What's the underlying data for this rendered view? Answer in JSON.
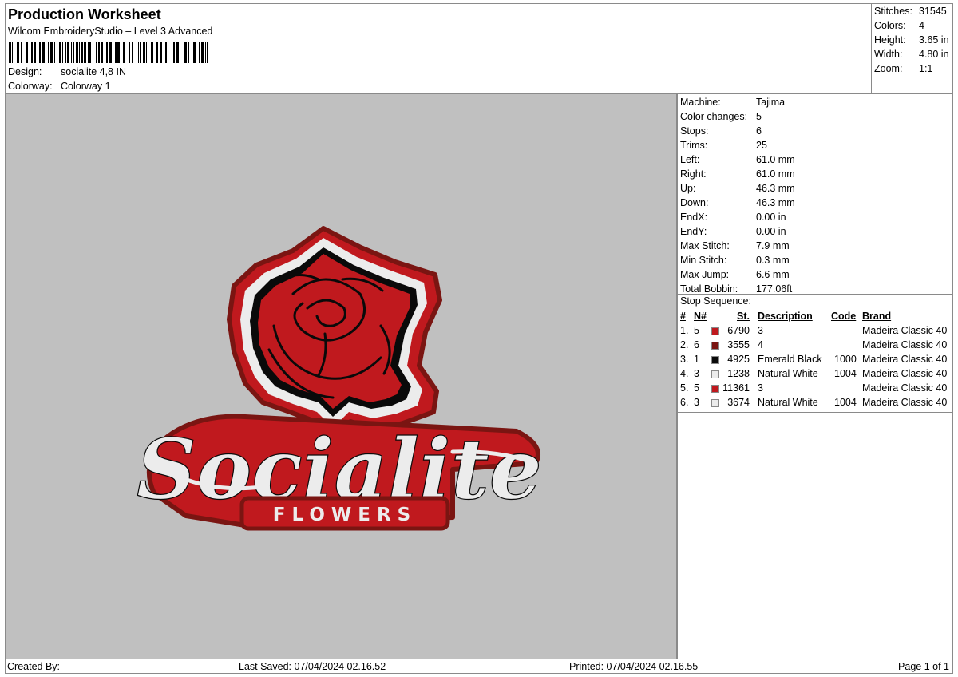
{
  "header": {
    "title": "Production Worksheet",
    "subtitle": "Wilcom EmbroideryStudio – Level 3 Advanced",
    "design_label": "Design:",
    "design_value": "socialite 4,8 IN",
    "colorway_label": "Colorway:",
    "colorway_value": "Colorway 1"
  },
  "stats": [
    {
      "label": "Stitches:",
      "value": "31545"
    },
    {
      "label": "Colors:",
      "value": "4"
    },
    {
      "label": "Height:",
      "value": "3.65 in"
    },
    {
      "label": "Width:",
      "value": "4.80 in"
    },
    {
      "label": "Zoom:",
      "value": "1:1"
    }
  ],
  "info": [
    {
      "label": "Machine:",
      "value": "Tajima"
    },
    {
      "label": "Color changes:",
      "value": "5"
    },
    {
      "label": "Stops:",
      "value": "6"
    },
    {
      "label": "Trims:",
      "value": "25"
    },
    {
      "label": "Left:",
      "value": "61.0 mm"
    },
    {
      "label": "Right:",
      "value": "61.0 mm"
    },
    {
      "label": "Up:",
      "value": "46.3 mm"
    },
    {
      "label": "Down:",
      "value": "46.3 mm"
    },
    {
      "label": "EndX:",
      "value": "0.00 in"
    },
    {
      "label": "EndY:",
      "value": "0.00 in"
    },
    {
      "label": "Max Stitch:",
      "value": "7.9 mm"
    },
    {
      "label": "Min Stitch:",
      "value": "0.3 mm"
    },
    {
      "label": "Max Jump:",
      "value": "6.6 mm"
    },
    {
      "label": "Total Bobbin:",
      "value": "177.06ft"
    }
  ],
  "stop_sequence": {
    "title": "Stop Sequence:",
    "headers": {
      "num": "#",
      "n": "N#",
      "st": "St.",
      "description": "Description",
      "code": "Code",
      "brand": "Brand"
    },
    "rows": [
      {
        "num": "1.",
        "n": "5",
        "color": "#c0191e",
        "st": "6790",
        "description": "3",
        "code": "",
        "brand": "Madeira Classic 40"
      },
      {
        "num": "2.",
        "n": "6",
        "color": "#7a1512",
        "st": "3555",
        "description": "4",
        "code": "",
        "brand": "Madeira Classic 40"
      },
      {
        "num": "3.",
        "n": "1",
        "color": "#0a0a0a",
        "st": "4925",
        "description": "Emerald Black",
        "code": "1000",
        "brand": "Madeira Classic 40"
      },
      {
        "num": "4.",
        "n": "3",
        "color": "#ececec",
        "st": "1238",
        "description": "Natural White",
        "code": "1004",
        "brand": "Madeira Classic 40"
      },
      {
        "num": "5.",
        "n": "5",
        "color": "#c0191e",
        "st": "11361",
        "description": "3",
        "code": "",
        "brand": "Madeira Classic 40"
      },
      {
        "num": "6.",
        "n": "3",
        "color": "#ececec",
        "st": "3674",
        "description": "Natural White",
        "code": "1004",
        "brand": "Madeira Classic 40"
      }
    ]
  },
  "design_art": {
    "word": "Socialite",
    "subword": "FLOWERS",
    "colors": {
      "red": "#c0191e",
      "dark_red": "#7a1512",
      "black": "#0a0a0a",
      "white": "#ececec",
      "canvas": "#c0c0c0"
    }
  },
  "footer": {
    "created_by": "Created By:",
    "last_saved": "Last Saved: 07/04/2024 02.16.52",
    "printed": "Printed: 07/04/2024 02.16.55",
    "page": "Page 1 of 1"
  }
}
